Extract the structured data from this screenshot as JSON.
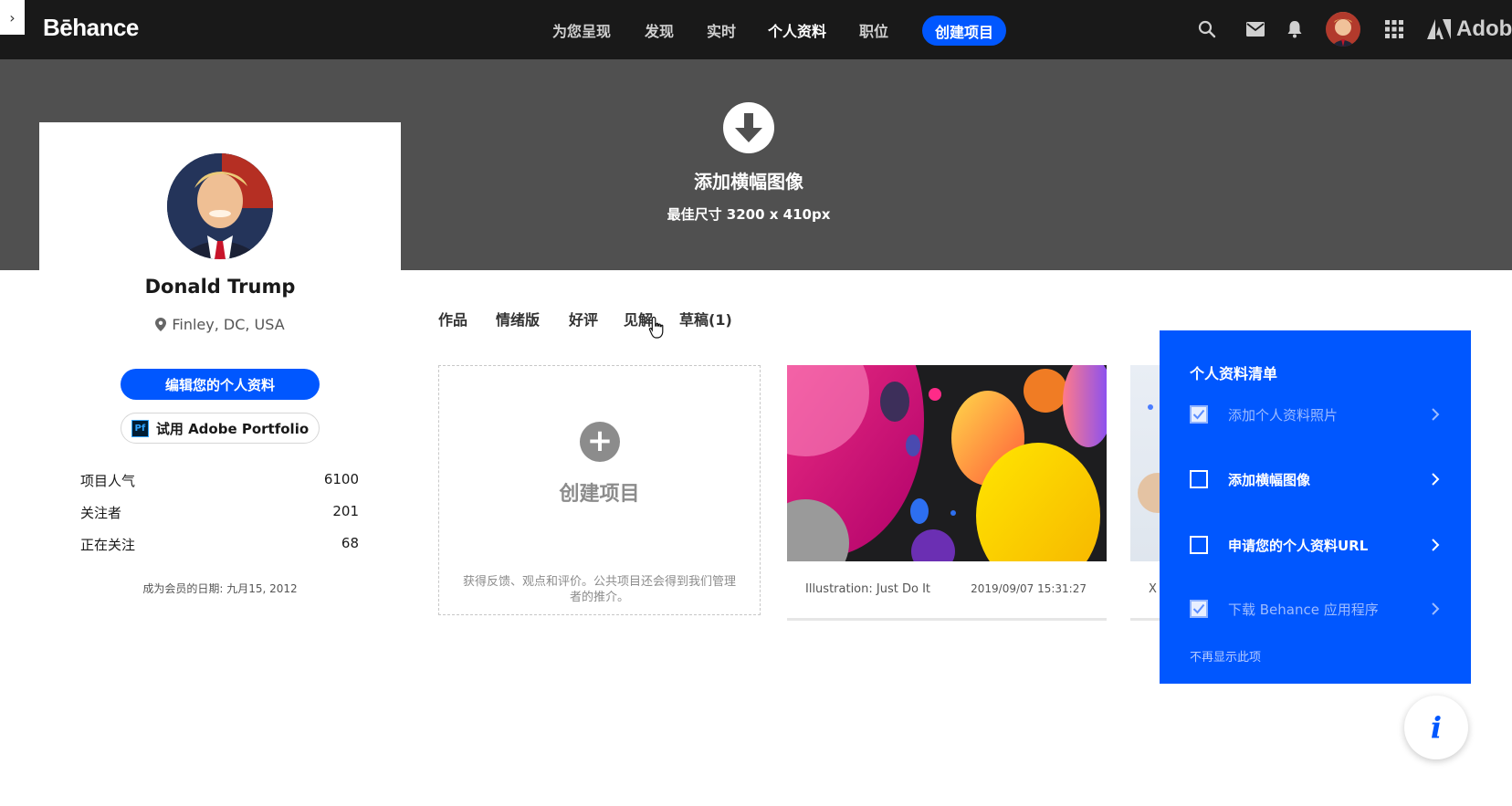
{
  "header": {
    "logo": "Bēhance",
    "nav": [
      "为您呈现",
      "发现",
      "实时",
      "个人资料",
      "职位"
    ],
    "active_nav": "个人资料",
    "create_label": "创建项目",
    "adobe_label": "Adobe"
  },
  "banner": {
    "title": "添加横幅图像",
    "subtitle": "最佳尺寸 3200 x 410px"
  },
  "profile": {
    "name": "Donald Trump",
    "location": "Finley, DC, USA",
    "edit_label": "编辑您的个人资料",
    "portfolio_label": "试用 Adobe Portfolio",
    "portfolio_badge": "Pf",
    "stats": [
      {
        "label": "项目人气",
        "value": "6100"
      },
      {
        "label": "关注者",
        "value": "201"
      },
      {
        "label": "正在关注",
        "value": "68"
      }
    ],
    "member_since": "成为会员的日期: 九月15, 2012"
  },
  "tabs": [
    "作品",
    "情绪版",
    "好评",
    "见解",
    "草稿(1)"
  ],
  "create_card": {
    "title": "创建项目",
    "description": "获得反馈、观点和评价。公共项目还会得到我们管理者的推介。"
  },
  "projects": [
    {
      "title": "Illustration: Just Do It",
      "date": "2019/09/07 15:31:27"
    },
    {
      "title": "X",
      "date": ""
    }
  ],
  "checklist": {
    "title": "个人资料清单",
    "items": [
      {
        "label": "添加个人资料照片",
        "done": true
      },
      {
        "label": "添加横幅图像",
        "done": false
      },
      {
        "label": "申请您的个人资料URL",
        "done": false
      },
      {
        "label": "下载 Behance 应用程序",
        "done": true
      }
    ],
    "dismiss": "不再显示此项"
  },
  "info_fab": "i",
  "colors": {
    "brand_blue": "#0057ff",
    "topbar": "#191919",
    "banner": "#505050"
  }
}
